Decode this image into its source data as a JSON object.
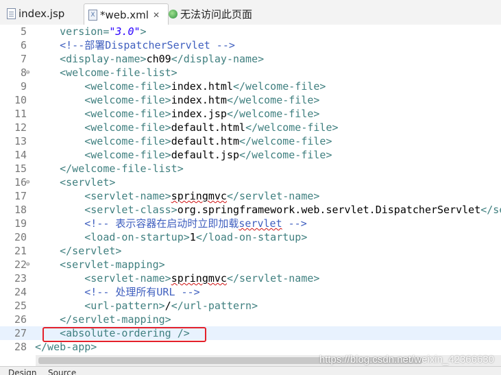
{
  "tabs": [
    {
      "label": "index.jsp",
      "icon": "jsp-file-icon"
    },
    {
      "label": "*web.xml",
      "icon": "xml-file-icon",
      "active": true
    },
    {
      "label": "无法访问此页面",
      "icon": "browser-globe-icon"
    }
  ],
  "editor": {
    "current_line": "27",
    "lines": [
      {
        "num": "5",
        "text": "    version=\"3.0\">"
      },
      {
        "num": "6",
        "text": "    <!--部署DispatcherServlet -->"
      },
      {
        "num": "7",
        "text": "    <display-name>ch09</display-name>"
      },
      {
        "num": "8",
        "text": "    <welcome-file-list>"
      },
      {
        "num": "9",
        "text": "        <welcome-file>index.html</welcome-file>"
      },
      {
        "num": "10",
        "text": "        <welcome-file>index.htm</welcome-file>"
      },
      {
        "num": "11",
        "text": "        <welcome-file>index.jsp</welcome-file>"
      },
      {
        "num": "12",
        "text": "        <welcome-file>default.html</welcome-file>"
      },
      {
        "num": "13",
        "text": "        <welcome-file>default.htm</welcome-file>"
      },
      {
        "num": "14",
        "text": "        <welcome-file>default.jsp</welcome-file>"
      },
      {
        "num": "15",
        "text": "    </welcome-file-list>"
      },
      {
        "num": "16",
        "text": "    <servlet>"
      },
      {
        "num": "17",
        "text": "        <servlet-name>springmvc</servlet-name>"
      },
      {
        "num": "18",
        "text": "        <servlet-class>org.springframework.web.servlet.DispatcherServlet</se"
      },
      {
        "num": "19",
        "text": "        <!-- 表示容器在启动时立即加载servlet -->"
      },
      {
        "num": "20",
        "text": "        <load-on-startup>1</load-on-startup>"
      },
      {
        "num": "21",
        "text": "    </servlet>"
      },
      {
        "num": "22",
        "text": "    <servlet-mapping>"
      },
      {
        "num": "23",
        "text": "        <servlet-name>springmvc</servlet-name>"
      },
      {
        "num": "24",
        "text": "        <!-- 处理所有URL -->"
      },
      {
        "num": "25",
        "text": "        <url-pattern>/</url-pattern>"
      },
      {
        "num": "26",
        "text": "    </servlet-mapping>"
      },
      {
        "num": "27",
        "text": "    <absolute-ordering />"
      },
      {
        "num": "28",
        "text": "</web-app>"
      }
    ]
  },
  "bottom_tabs": [
    "Design",
    "Source"
  ],
  "watermark": "https://blog.csdn.net/weixin_42366630",
  "colors": {
    "tag": "#3f7f7f",
    "attribute_value": "#2a00ff",
    "comment": "#3f5fbf",
    "current_line_bg": "#e8f2fe",
    "annotation_box": "#e4202a"
  }
}
